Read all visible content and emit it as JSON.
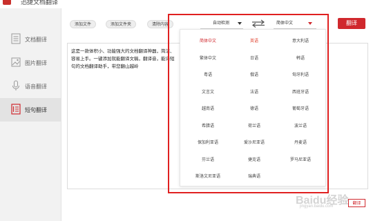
{
  "window": {
    "title": "迅捷文档翻译"
  },
  "sidebar": {
    "items": [
      {
        "label": "文档翻译",
        "icon": "document-icon"
      },
      {
        "label": "图片翻译",
        "icon": "image-icon"
      },
      {
        "label": "语音翻译",
        "icon": "microphone-icon"
      },
      {
        "label": "短句翻译",
        "icon": "phrase-icon"
      }
    ],
    "active_index": 3
  },
  "toolbar": {
    "add_file": "添加文件",
    "add_folder": "添加文件夹",
    "clear": "清除内容"
  },
  "language": {
    "source": "自动检测",
    "target": "简体中文",
    "swap_icon": "swap-icon"
  },
  "translate_label": "翻译",
  "source_text": "这是一款体积小、功能强大的文档翻译神器，简洁、容易上手。一键添加就能翻译文稿，翻译音，能译短句的文档翻译助手，带您翻山越岭",
  "dropdown": {
    "options": [
      "简体中文",
      "英语",
      "意大利语",
      "繁体中文",
      "日语",
      "韩语",
      "粤语",
      "俄语",
      "匈牙利语",
      "文言文",
      "法语",
      "西班牙语",
      "越南语",
      "德语",
      "葡萄牙语",
      "希腊语",
      "荷兰语",
      "波兰语",
      "保加利亚语",
      "爱沙尼亚语",
      "丹麦语",
      "芬兰语",
      "捷克语",
      "罗马尼亚语",
      "斯洛文尼亚语",
      "瑞典语"
    ],
    "selected": "简体中文",
    "hover": "英语"
  },
  "bottom_translate_label": "翻译",
  "watermark": {
    "text": "Baidu经验",
    "sub": "jingyan.baidu.com"
  },
  "colors": {
    "accent": "#d0282d",
    "highlight_frame": "#e02020"
  }
}
